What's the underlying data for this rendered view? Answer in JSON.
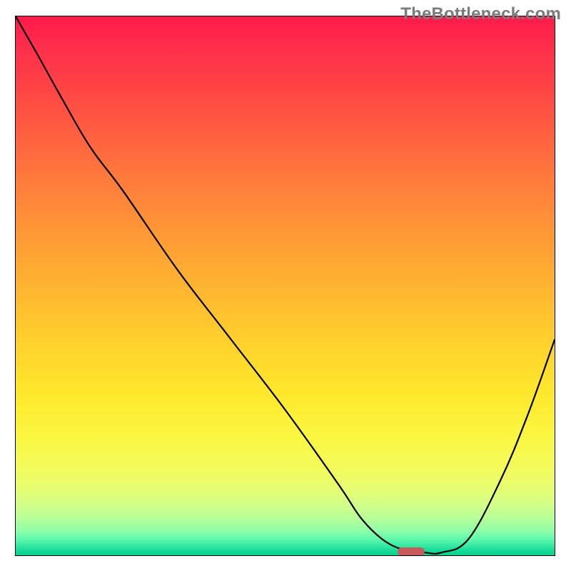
{
  "watermark": "TheBottleneck.com",
  "chart_data": {
    "type": "line",
    "title": "",
    "xlabel": "",
    "ylabel": "",
    "xlim": [
      0,
      100
    ],
    "ylim": [
      0,
      100
    ],
    "series": [
      {
        "name": "bottleneck-curve",
        "x": [
          0,
          4,
          9,
          14,
          20,
          30,
          40,
          50,
          60,
          64,
          68,
          72,
          76,
          79,
          84,
          90,
          95,
          100
        ],
        "values": [
          100,
          93,
          84,
          75.5,
          67.5,
          53,
          40,
          27,
          13,
          7,
          3,
          1,
          0.5,
          0.5,
          3,
          14,
          26,
          40
        ]
      }
    ],
    "marker": {
      "name": "solution-marker",
      "x_start": 71,
      "x_end": 76,
      "y": 0.5,
      "color": "#c75a5a"
    },
    "gradient": {
      "orientation": "vertical",
      "stops": [
        {
          "pos": 0,
          "color": "#ff1a4b"
        },
        {
          "pos": 0.5,
          "color": "#ffb431"
        },
        {
          "pos": 0.8,
          "color": "#fbf741"
        },
        {
          "pos": 1.0,
          "color": "#0dd18f"
        }
      ]
    }
  }
}
